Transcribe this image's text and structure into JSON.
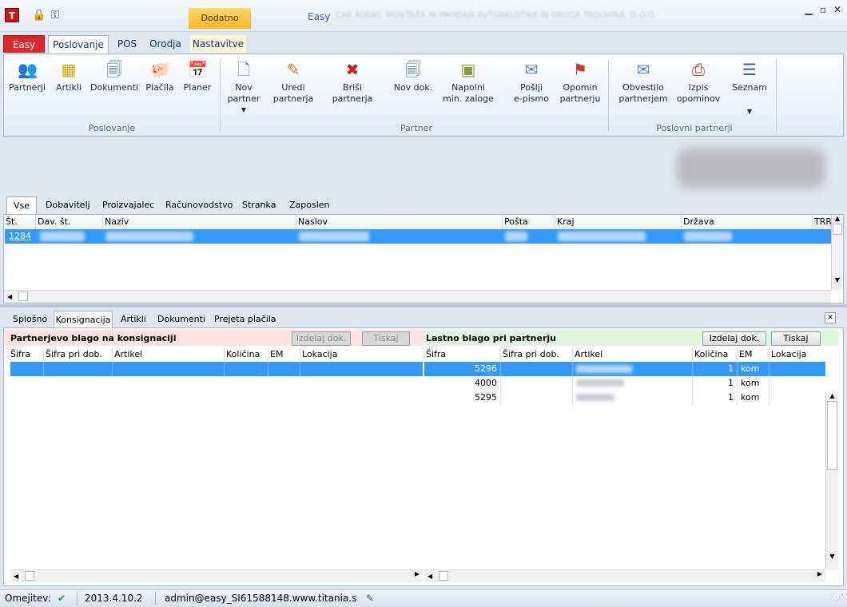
{
  "window": {
    "app_name": "Easy",
    "subtitle_blurred": "CAR AUDIO, MONTAŽA IN PRODAJA AVTOAKUSTIKE IN DRUGA TRGOVINA, D.O.O.",
    "min_icon": "minimize-icon",
    "max_icon": "maximize-icon",
    "close_icon": "close-icon"
  },
  "ribbon": {
    "context_header": "Dodatno",
    "tabs": [
      "Easy",
      "Poslovanje",
      "POS",
      "Orodja",
      "Nastavitve"
    ],
    "groups": [
      {
        "label": "Poslovanje",
        "buttons": [
          {
            "label": "Partnerji",
            "icon": "partners-icon"
          },
          {
            "label": "Artikli",
            "icon": "articles-icon"
          },
          {
            "label": "Dokumenti",
            "icon": "documents-icon"
          },
          {
            "label": "Plačila",
            "icon": "payments-icon"
          },
          {
            "label": "Planer",
            "icon": "calendar-icon"
          }
        ]
      },
      {
        "label": "Partner",
        "buttons": [
          {
            "label": "Nov\npartner",
            "icon": "new-document-icon"
          },
          {
            "label": "Uredi\npartnerja",
            "icon": "edit-icon"
          },
          {
            "label": "Briši\npartnerja",
            "icon": "delete-icon"
          },
          {
            "label": "Nov dok.",
            "icon": "new-doc-icon"
          },
          {
            "label": "Napolni\nmin. zaloge",
            "icon": "fill-stock-icon"
          },
          {
            "label": "Pošlji\ne-pismo",
            "icon": "email-icon"
          },
          {
            "label": "Opomin\npartnerju",
            "icon": "reminder-icon"
          }
        ]
      },
      {
        "label": "Poslovni partnerji",
        "buttons": [
          {
            "label": "Obvestilo\npartnerjem",
            "icon": "notice-icon"
          },
          {
            "label": "Izpis\nopominov",
            "icon": "print-reminders-icon"
          },
          {
            "label": "Seznam",
            "icon": "list-icon"
          }
        ]
      }
    ]
  },
  "partner_tabs": [
    "Vse",
    "Dobavitelj",
    "Proizvajalec",
    "Računovodstvo",
    "Stranka",
    "Zaposlen"
  ],
  "partner_grid": {
    "columns": [
      "Št.",
      "Dav. št.",
      "Naziv",
      "Naslov",
      "Pošta",
      "Kraj",
      "Država",
      "TRR"
    ],
    "rows": [
      {
        "st": "1284"
      }
    ]
  },
  "bottom_tabs": [
    "Splošno",
    "Konsignacija",
    "Artikli",
    "Dokumenti",
    "Prejeta plačila"
  ],
  "left_panel": {
    "title": "Partnerjevo blago na konsignaciji",
    "btn_create": "Izdelaj dok.",
    "btn_print": "Tiskaj",
    "columns": [
      "Šifra",
      "Šifra pri dob.",
      "Artikel",
      "Količina",
      "EM",
      "Lokacija"
    ]
  },
  "right_panel": {
    "title": "Lastno blago pri partnerju",
    "btn_create": "Izdelaj dok.",
    "btn_print": "Tiskaj",
    "columns": [
      "Šifra",
      "Šifra pri dob.",
      "Artikel",
      "Količina",
      "EM",
      "Lokacija"
    ],
    "rows": [
      {
        "sifra": "5296",
        "kolicina": "1",
        "em": "kom"
      },
      {
        "sifra": "4000",
        "kolicina": "1",
        "em": "kom"
      },
      {
        "sifra": "5295",
        "kolicina": "1",
        "em": "kom"
      }
    ]
  },
  "status": {
    "label": "Omejitev:",
    "version": "2013.4.10.2",
    "user": "admin@easy_SI61588148.www.titania.s"
  }
}
